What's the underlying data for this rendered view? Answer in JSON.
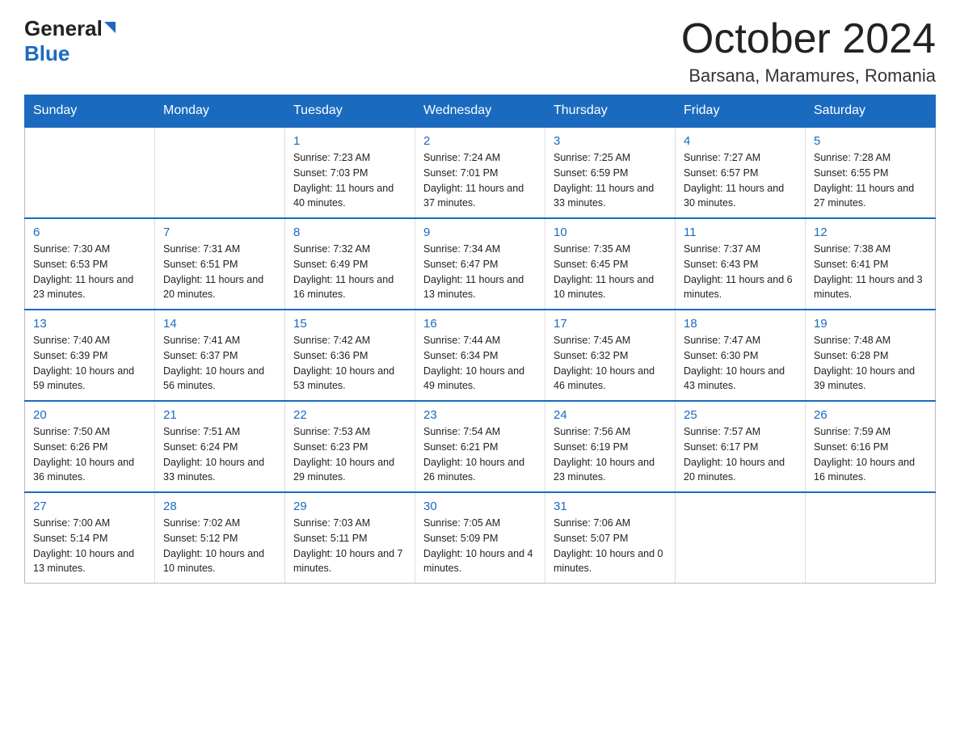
{
  "logo": {
    "general": "General",
    "blue": "Blue"
  },
  "title": "October 2024",
  "subtitle": "Barsana, Maramures, Romania",
  "weekdays": [
    "Sunday",
    "Monday",
    "Tuesday",
    "Wednesday",
    "Thursday",
    "Friday",
    "Saturday"
  ],
  "weeks": [
    [
      {
        "day": "",
        "info": ""
      },
      {
        "day": "",
        "info": ""
      },
      {
        "day": "1",
        "info": "Sunrise: 7:23 AM\nSunset: 7:03 PM\nDaylight: 11 hours\nand 40 minutes."
      },
      {
        "day": "2",
        "info": "Sunrise: 7:24 AM\nSunset: 7:01 PM\nDaylight: 11 hours\nand 37 minutes."
      },
      {
        "day": "3",
        "info": "Sunrise: 7:25 AM\nSunset: 6:59 PM\nDaylight: 11 hours\nand 33 minutes."
      },
      {
        "day": "4",
        "info": "Sunrise: 7:27 AM\nSunset: 6:57 PM\nDaylight: 11 hours\nand 30 minutes."
      },
      {
        "day": "5",
        "info": "Sunrise: 7:28 AM\nSunset: 6:55 PM\nDaylight: 11 hours\nand 27 minutes."
      }
    ],
    [
      {
        "day": "6",
        "info": "Sunrise: 7:30 AM\nSunset: 6:53 PM\nDaylight: 11 hours\nand 23 minutes."
      },
      {
        "day": "7",
        "info": "Sunrise: 7:31 AM\nSunset: 6:51 PM\nDaylight: 11 hours\nand 20 minutes."
      },
      {
        "day": "8",
        "info": "Sunrise: 7:32 AM\nSunset: 6:49 PM\nDaylight: 11 hours\nand 16 minutes."
      },
      {
        "day": "9",
        "info": "Sunrise: 7:34 AM\nSunset: 6:47 PM\nDaylight: 11 hours\nand 13 minutes."
      },
      {
        "day": "10",
        "info": "Sunrise: 7:35 AM\nSunset: 6:45 PM\nDaylight: 11 hours\nand 10 minutes."
      },
      {
        "day": "11",
        "info": "Sunrise: 7:37 AM\nSunset: 6:43 PM\nDaylight: 11 hours\nand 6 minutes."
      },
      {
        "day": "12",
        "info": "Sunrise: 7:38 AM\nSunset: 6:41 PM\nDaylight: 11 hours\nand 3 minutes."
      }
    ],
    [
      {
        "day": "13",
        "info": "Sunrise: 7:40 AM\nSunset: 6:39 PM\nDaylight: 10 hours\nand 59 minutes."
      },
      {
        "day": "14",
        "info": "Sunrise: 7:41 AM\nSunset: 6:37 PM\nDaylight: 10 hours\nand 56 minutes."
      },
      {
        "day": "15",
        "info": "Sunrise: 7:42 AM\nSunset: 6:36 PM\nDaylight: 10 hours\nand 53 minutes."
      },
      {
        "day": "16",
        "info": "Sunrise: 7:44 AM\nSunset: 6:34 PM\nDaylight: 10 hours\nand 49 minutes."
      },
      {
        "day": "17",
        "info": "Sunrise: 7:45 AM\nSunset: 6:32 PM\nDaylight: 10 hours\nand 46 minutes."
      },
      {
        "day": "18",
        "info": "Sunrise: 7:47 AM\nSunset: 6:30 PM\nDaylight: 10 hours\nand 43 minutes."
      },
      {
        "day": "19",
        "info": "Sunrise: 7:48 AM\nSunset: 6:28 PM\nDaylight: 10 hours\nand 39 minutes."
      }
    ],
    [
      {
        "day": "20",
        "info": "Sunrise: 7:50 AM\nSunset: 6:26 PM\nDaylight: 10 hours\nand 36 minutes."
      },
      {
        "day": "21",
        "info": "Sunrise: 7:51 AM\nSunset: 6:24 PM\nDaylight: 10 hours\nand 33 minutes."
      },
      {
        "day": "22",
        "info": "Sunrise: 7:53 AM\nSunset: 6:23 PM\nDaylight: 10 hours\nand 29 minutes."
      },
      {
        "day": "23",
        "info": "Sunrise: 7:54 AM\nSunset: 6:21 PM\nDaylight: 10 hours\nand 26 minutes."
      },
      {
        "day": "24",
        "info": "Sunrise: 7:56 AM\nSunset: 6:19 PM\nDaylight: 10 hours\nand 23 minutes."
      },
      {
        "day": "25",
        "info": "Sunrise: 7:57 AM\nSunset: 6:17 PM\nDaylight: 10 hours\nand 20 minutes."
      },
      {
        "day": "26",
        "info": "Sunrise: 7:59 AM\nSunset: 6:16 PM\nDaylight: 10 hours\nand 16 minutes."
      }
    ],
    [
      {
        "day": "27",
        "info": "Sunrise: 7:00 AM\nSunset: 5:14 PM\nDaylight: 10 hours\nand 13 minutes."
      },
      {
        "day": "28",
        "info": "Sunrise: 7:02 AM\nSunset: 5:12 PM\nDaylight: 10 hours\nand 10 minutes."
      },
      {
        "day": "29",
        "info": "Sunrise: 7:03 AM\nSunset: 5:11 PM\nDaylight: 10 hours\nand 7 minutes."
      },
      {
        "day": "30",
        "info": "Sunrise: 7:05 AM\nSunset: 5:09 PM\nDaylight: 10 hours\nand 4 minutes."
      },
      {
        "day": "31",
        "info": "Sunrise: 7:06 AM\nSunset: 5:07 PM\nDaylight: 10 hours\nand 0 minutes."
      },
      {
        "day": "",
        "info": ""
      },
      {
        "day": "",
        "info": ""
      }
    ]
  ]
}
